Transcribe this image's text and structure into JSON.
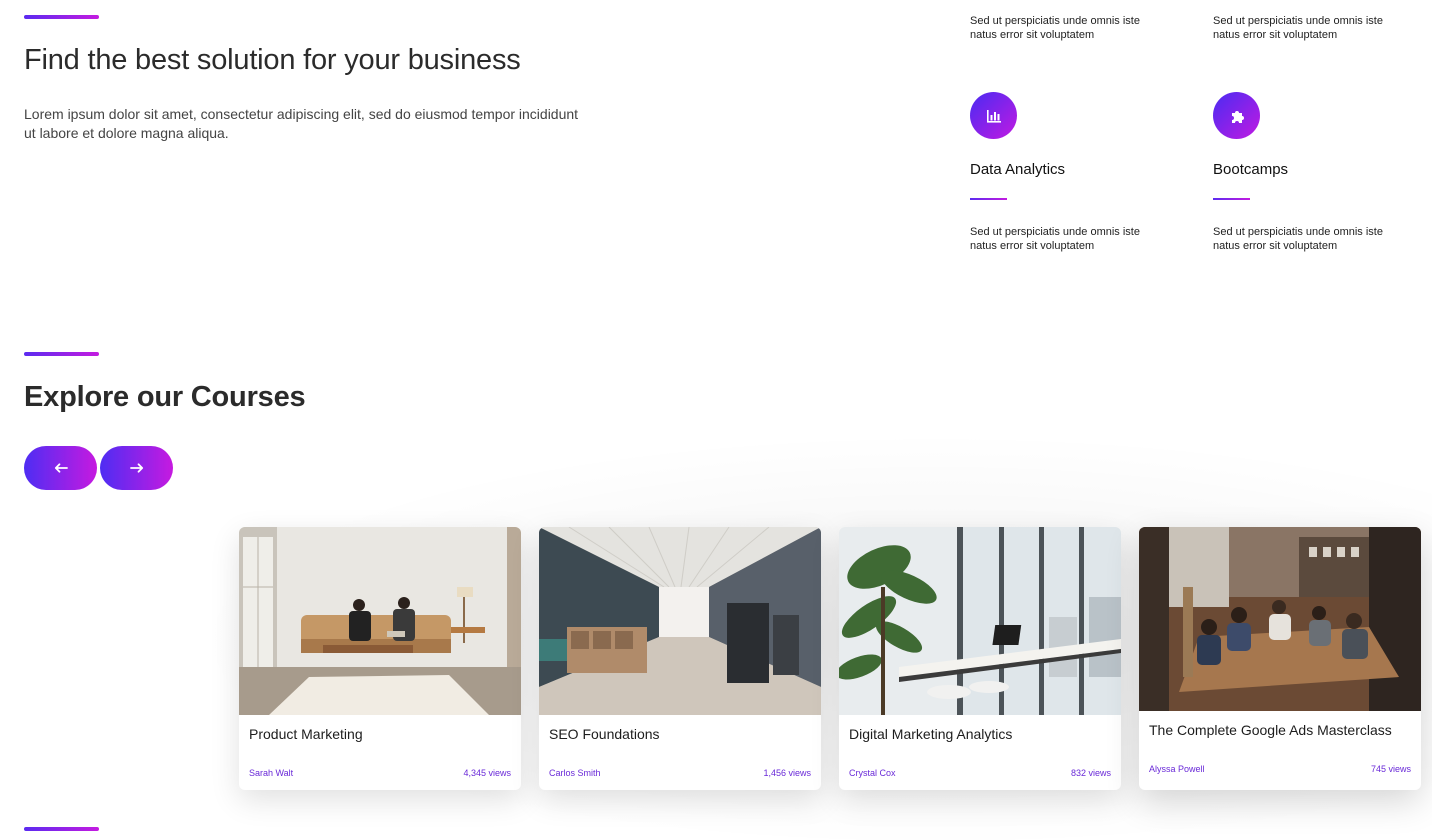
{
  "hero": {
    "title": "Find the best solution for your business",
    "text": "Lorem ipsum dolor sit amet, consectetur adipiscing elit, sed do eiusmod tempor incididunt ut labore et dolore magna aliqua."
  },
  "features": {
    "top_desc_left": "Sed ut perspiciatis unde omnis iste natus error sit voluptatem",
    "top_desc_right": "Sed ut perspiciatis unde omnis iste natus error sit voluptatem",
    "items": [
      {
        "title": "Data Analytics",
        "icon": "bar-chart-icon",
        "desc": "Sed ut perspiciatis unde omnis iste natus error sit voluptatem"
      },
      {
        "title": "Bootcamps",
        "icon": "puzzle-icon",
        "desc": "Sed ut perspiciatis unde omnis iste natus error sit voluptatem"
      }
    ]
  },
  "courses": {
    "title": "Explore our Courses",
    "prev_label": "←",
    "next_label": "→",
    "cards": [
      {
        "title": "Product Marketing",
        "author": "Sarah Walt",
        "views": "4,345 views"
      },
      {
        "title": "SEO Foundations",
        "author": "Carlos Smith",
        "views": "1,456 views"
      },
      {
        "title": "Digital Marketing Analytics",
        "author": "Crystal Cox",
        "views": "832 views"
      },
      {
        "title": "The Complete Google Ads Masterclass",
        "author": "Alyssa Powell",
        "views": "745 views"
      }
    ]
  },
  "colors": {
    "accent_start": "#5b2bf0",
    "accent_end": "#c41be0",
    "meta": "#6a2ad8"
  }
}
